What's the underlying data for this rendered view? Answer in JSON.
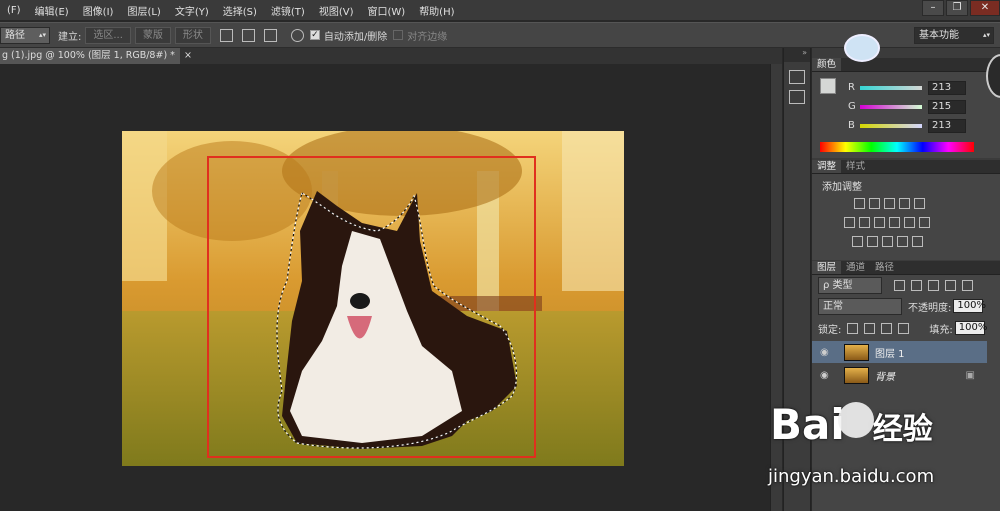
{
  "menu": [
    "(F)",
    "编辑(E)",
    "图像(I)",
    "图层(L)",
    "文字(Y)",
    "选择(S)",
    "滤镜(T)",
    "视图(V)",
    "窗口(W)",
    "帮助(H)"
  ],
  "window_controls": {
    "min": "–",
    "restore": "❐",
    "close": "✕"
  },
  "options": {
    "tool_mode": "路径",
    "make_label": "建立:",
    "selection_btn": "选区...",
    "mask_btn": "蒙版",
    "shape_btn": "形状",
    "auto_add_delete": "自动添加/删除",
    "align_edges": "对齐边缘",
    "workspace": "基本功能"
  },
  "document": {
    "tab_title": "g (1).jpg @ 100% (图层 1, RGB/8#) *",
    "close": "×"
  },
  "color_panel": {
    "tab_color": "颜色",
    "r_label": "R",
    "g_label": "G",
    "b_label": "B",
    "r": "213",
    "g": "215",
    "b": "213"
  },
  "adjust_panel": {
    "tab_adjust": "调整",
    "tab_style": "样式",
    "add_label": "添加调整"
  },
  "layers_panel": {
    "tab_layers": "图层",
    "tab_channels": "通道",
    "tab_paths": "路径",
    "filter_kind": "ρ 类型",
    "blend_mode": "正常",
    "opacity_label": "不透明度:",
    "opacity": "100%",
    "lock_label": "锁定:",
    "fill_label": "填充:",
    "fill": "100%",
    "layers": [
      {
        "name": "图层 1",
        "selected": true
      },
      {
        "name": "背景",
        "selected": false
      }
    ]
  },
  "watermark": {
    "brand": "Bai",
    "brand2": "经验",
    "url": "jingyan.baidu.com"
  },
  "colors": {
    "selection_rect": "#e0301e",
    "accent": "#5a6e86"
  }
}
